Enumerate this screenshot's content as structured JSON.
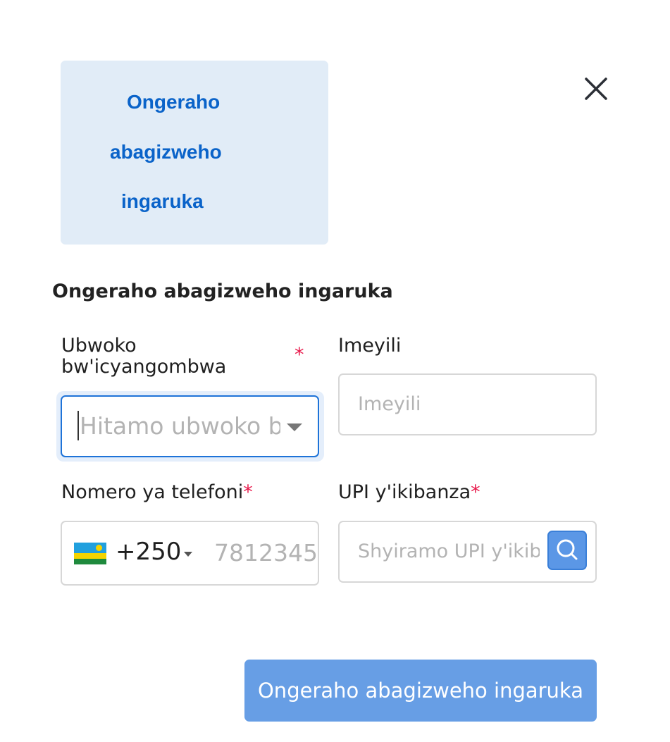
{
  "tab": {
    "title_lines": [
      "Ongeraho",
      "abagizweho",
      "ingaruka"
    ]
  },
  "close": {
    "icon": "close-icon"
  },
  "form": {
    "title": "Ongeraho abagizweho ingaruka",
    "permit_type": {
      "label_line1": "Ubwoko",
      "label_line2": "bw'icyangombwa",
      "required": "*",
      "placeholder": "Hitamo ubwoko bw"
    },
    "email": {
      "label": "Imeyili",
      "placeholder": "Imeyili"
    },
    "phone": {
      "label": "Nomero ya telefoni",
      "required": "*",
      "country_code": "+250",
      "placeholder": "7812345"
    },
    "upi": {
      "label": "UPI y'ikibanza",
      "required": "*",
      "placeholder": "Shyiramo UPI y'ikib",
      "search_icon": "search-icon"
    },
    "submit_label": "Ongeraho abagizweho ingaruka"
  },
  "colors": {
    "accent": "#0a63c9",
    "required": "#e8194b",
    "button": "#679ee5",
    "tab_bg": "#e1ecf7"
  }
}
